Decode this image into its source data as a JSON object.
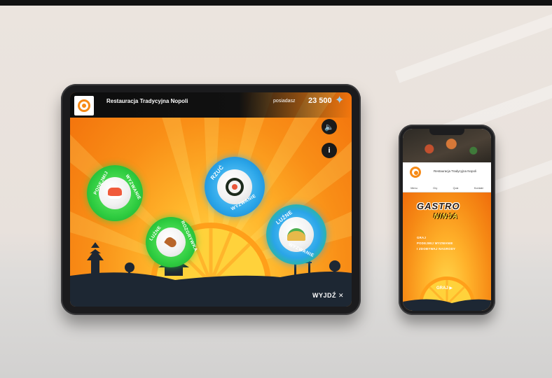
{
  "colors": {
    "accent": "#f68a16",
    "ring_green": "#2ecc40",
    "ring_blue": "#2aa5e8",
    "dark": "#1b1b1d"
  },
  "tablet": {
    "restaurant_name": "Restauracja Tradycyjna Nopoli",
    "points_label": "posiadasz",
    "points_value": "23 500",
    "exit_label": "WYJDŹ",
    "exit_icon": "close-icon",
    "sound_icon": "speaker-icon",
    "info_icon": "info-icon",
    "info_glyph": "i",
    "challenges": [
      {
        "top": "PODEJMIJ",
        "bottom": "WYZWANIE",
        "food": "sushi-nigiri",
        "ring": "green"
      },
      {
        "top": "RZUĆ",
        "bottom": "WYZWANIE",
        "food": "sushi-roll",
        "ring": "blue"
      },
      {
        "top": "LUŹNE",
        "bottom": "ROZGRYWKA",
        "food": "chicken-leg",
        "ring": "green"
      },
      {
        "top": "LUŹNE",
        "bottom": "WYZWANIE",
        "food": "taco",
        "ring": "blue"
      }
    ]
  },
  "phone": {
    "restaurant_name": "Restauracja Tradycyjna Nopoli",
    "tabs": [
      "Menu",
      "Gry",
      "Quiz",
      "Kontakt"
    ],
    "game_title_1": "GASTRO",
    "game_title_2": "NINJA",
    "lines": [
      "GRAJ",
      "PODEJMIJ WYZWANIE",
      "I ZDOBYWAJ NAGRODY"
    ],
    "play_label": "GRAJ ▶"
  }
}
